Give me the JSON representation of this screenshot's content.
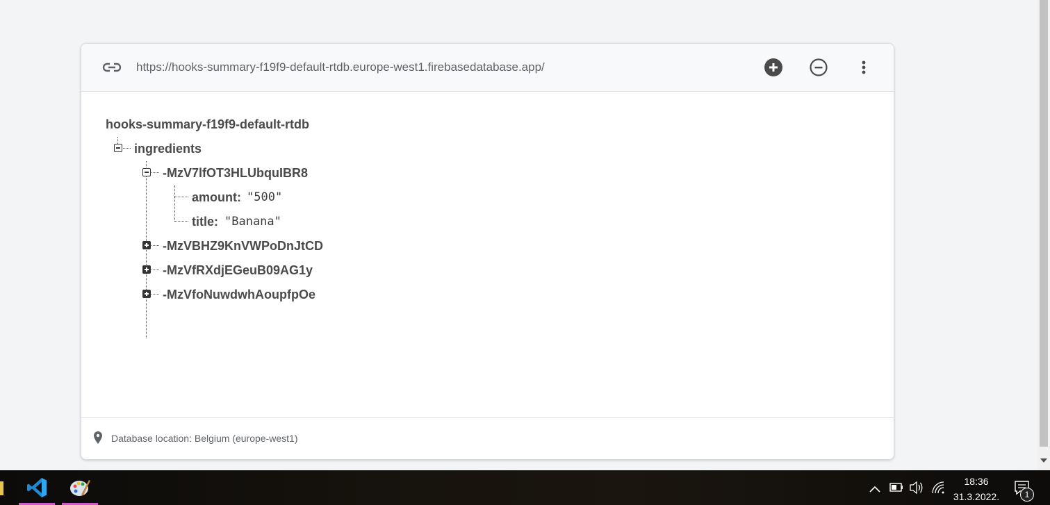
{
  "header": {
    "url": "https://hooks-summary-f19f9-default-rtdb.europe-west1.firebasedatabase.app/",
    "icons": [
      "link-icon",
      "add-circle-icon",
      "remove-circle-icon",
      "more-vert-icon"
    ]
  },
  "tree": {
    "root": "hooks-summary-f19f9-default-rtdb",
    "ingredients_key": "ingredients",
    "expanded_item": {
      "key": "-MzV7lfOT3HLUbquIBR8",
      "fields": [
        {
          "key": "amount:",
          "value": "\"500\""
        },
        {
          "key": "title:",
          "value": "\"Banana\""
        }
      ]
    },
    "collapsed_items": [
      "-MzVBHZ9KnVWPoDnJtCD",
      "-MzVfRXdjEGeuB09AG1y",
      "-MzVfoNuwdwhAoupfpOe"
    ]
  },
  "footer": {
    "location_text": "Database location: Belgium (europe-west1)"
  },
  "taskbar": {
    "time": "18:36",
    "date": "31.3.2022.",
    "notification_count": "1",
    "accent_color": "#c95cc5"
  }
}
